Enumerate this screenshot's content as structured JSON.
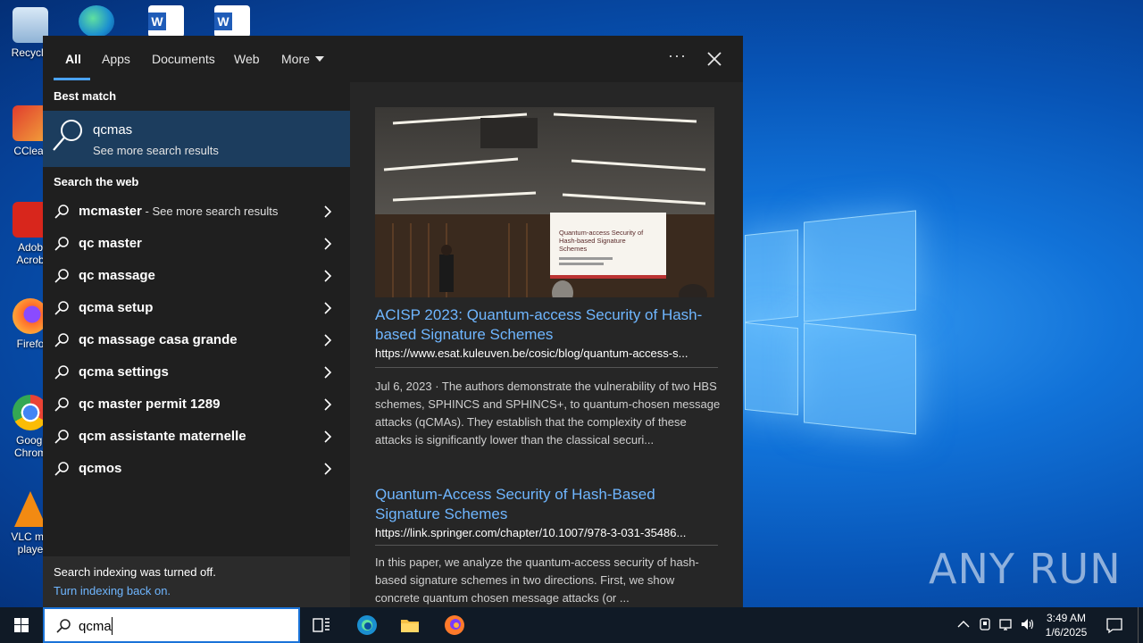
{
  "desktop": {
    "icons": [
      {
        "label": "Recycle",
        "icon": "recycle-bin-icon"
      },
      {
        "label": "CClear",
        "icon": "ccleaner-icon"
      },
      {
        "label": "Adob Acrob",
        "icon": "adobe-acrobat-icon"
      },
      {
        "label": "Firefo",
        "icon": "firefox-icon"
      },
      {
        "label": "Googl Chrom",
        "icon": "chrome-icon"
      },
      {
        "label": "VLC me playe",
        "icon": "vlc-icon"
      }
    ],
    "watermark": "ANY RUN"
  },
  "search_panel": {
    "tabs": [
      {
        "label": "All",
        "active": true
      },
      {
        "label": "Apps"
      },
      {
        "label": "Documents"
      },
      {
        "label": "Web"
      },
      {
        "label": "More"
      }
    ],
    "ellipsis": "···",
    "best_match_heading": "Best match",
    "best_match": {
      "title": "qcmas",
      "subtitle": "See more search results"
    },
    "search_web_heading": "Search the web",
    "suggestions": [
      {
        "text": "mcmaster",
        "extra": " - See more search results"
      },
      {
        "text": "qc master",
        "extra": ""
      },
      {
        "text": "qc massage",
        "extra": ""
      },
      {
        "text": "qcma setup",
        "extra": ""
      },
      {
        "text": "qc massage casa grande",
        "extra": ""
      },
      {
        "text": "qcma settings",
        "extra": ""
      },
      {
        "text": "qc master permit 1289",
        "extra": ""
      },
      {
        "text": "qcm assistante maternelle",
        "extra": ""
      },
      {
        "text": "qcmos",
        "extra": ""
      }
    ],
    "indexing": {
      "notice": "Search indexing was turned off.",
      "link": "Turn indexing back on."
    },
    "slide_text": "Quantum-access Security of Hash-based Signature Schemes",
    "results": [
      {
        "title": "ACISP 2023: Quantum-access Security of Hash-based Signature Schemes",
        "url": "https://www.esat.kuleuven.be/cosic/blog/quantum-access-s...",
        "description": "Jul 6, 2023 · The authors demonstrate the vulnerability of two HBS schemes, SPHINCS and SPHINCS+, to quantum-chosen message attacks (qCMAs). They establish that the complexity of these attacks is significantly lower than the classical securi..."
      },
      {
        "title": "Quantum-Access Security of Hash-Based Signature Schemes",
        "url": "https://link.springer.com/chapter/10.1007/978-3-031-35486...",
        "description": "In this paper, we analyze the quantum-access security of hash-based signature schemes in two directions. First, we show concrete quantum chosen message attacks (or ..."
      }
    ]
  },
  "taskbar": {
    "search_value": "qcma",
    "clock_time": "3:49 AM",
    "clock_date": "1/6/2025",
    "accent": "#1a73d8"
  }
}
